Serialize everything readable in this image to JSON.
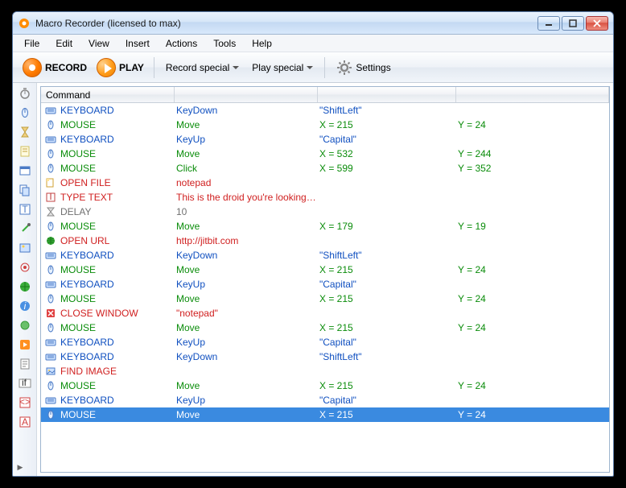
{
  "window": {
    "title": "Macro Recorder (licensed to max)"
  },
  "menubar": [
    "File",
    "Edit",
    "View",
    "Insert",
    "Actions",
    "Tools",
    "Help"
  ],
  "toolbar": {
    "record_label": "RECORD",
    "play_label": "PLAY",
    "record_special": "Record special",
    "play_special": "Play special",
    "settings_label": "Settings"
  },
  "list": {
    "header": "Command",
    "rows": [
      {
        "icon": "kb",
        "cmd": "KEYBOARD",
        "c1": "c-blue",
        "act": "KeyDown",
        "c2": "c-blue",
        "p1": "\"ShiftLeft\"",
        "c3": "c-blue",
        "p2": ""
      },
      {
        "icon": "ms",
        "cmd": "MOUSE",
        "c1": "c-green",
        "act": "Move",
        "c2": "c-green",
        "p1": "X = 215",
        "c3": "c-green",
        "p2": "Y = 24",
        "c4": "c-green"
      },
      {
        "icon": "kb",
        "cmd": "KEYBOARD",
        "c1": "c-blue",
        "act": "KeyUp",
        "c2": "c-blue",
        "p1": "\"Capital\"",
        "c3": "c-blue",
        "p2": ""
      },
      {
        "icon": "ms",
        "cmd": "MOUSE",
        "c1": "c-green",
        "act": "Move",
        "c2": "c-green",
        "p1": "X = 532",
        "c3": "c-green",
        "p2": "Y = 244",
        "c4": "c-green"
      },
      {
        "icon": "ms",
        "cmd": "MOUSE",
        "c1": "c-green",
        "act": "Click",
        "c2": "c-green",
        "p1": "X = 599",
        "c3": "c-green",
        "p2": "Y = 352",
        "c4": "c-green"
      },
      {
        "icon": "of",
        "cmd": "OPEN FILE",
        "c1": "c-red",
        "act": "notepad",
        "c2": "c-red",
        "p1": "",
        "c3": "",
        "p2": ""
      },
      {
        "icon": "tt",
        "cmd": "TYPE TEXT",
        "c1": "c-red",
        "act": "This is the droid you're looking for!",
        "c2": "c-red",
        "p1": "",
        "c3": "",
        "p2": ""
      },
      {
        "icon": "dl",
        "cmd": "DELAY",
        "c1": "c-gray",
        "act": "10",
        "c2": "c-gray",
        "p1": "",
        "c3": "",
        "p2": ""
      },
      {
        "icon": "ms",
        "cmd": "MOUSE",
        "c1": "c-green",
        "act": "Move",
        "c2": "c-green",
        "p1": "X = 179",
        "c3": "c-green",
        "p2": "Y = 19",
        "c4": "c-green"
      },
      {
        "icon": "ou",
        "cmd": "OPEN URL",
        "c1": "c-red",
        "act": "http://jitbit.com",
        "c2": "c-red",
        "p1": "",
        "c3": "",
        "p2": ""
      },
      {
        "icon": "kb",
        "cmd": "KEYBOARD",
        "c1": "c-blue",
        "act": "KeyDown",
        "c2": "c-blue",
        "p1": "\"ShiftLeft\"",
        "c3": "c-blue",
        "p2": ""
      },
      {
        "icon": "ms",
        "cmd": "MOUSE",
        "c1": "c-green",
        "act": "Move",
        "c2": "c-green",
        "p1": "X = 215",
        "c3": "c-green",
        "p2": "Y = 24",
        "c4": "c-green"
      },
      {
        "icon": "kb",
        "cmd": "KEYBOARD",
        "c1": "c-blue",
        "act": "KeyUp",
        "c2": "c-blue",
        "p1": "\"Capital\"",
        "c3": "c-blue",
        "p2": ""
      },
      {
        "icon": "ms",
        "cmd": "MOUSE",
        "c1": "c-green",
        "act": "Move",
        "c2": "c-green",
        "p1": "X = 215",
        "c3": "c-green",
        "p2": "Y = 24",
        "c4": "c-green"
      },
      {
        "icon": "cw",
        "cmd": "CLOSE WINDOW",
        "c1": "c-red",
        "act": "\"notepad\"",
        "c2": "c-red",
        "p1": "",
        "c3": "",
        "p2": ""
      },
      {
        "icon": "ms",
        "cmd": "MOUSE",
        "c1": "c-green",
        "act": "Move",
        "c2": "c-green",
        "p1": "X = 215",
        "c3": "c-green",
        "p2": "Y = 24",
        "c4": "c-green"
      },
      {
        "icon": "kb",
        "cmd": "KEYBOARD",
        "c1": "c-blue",
        "act": "KeyUp",
        "c2": "c-blue",
        "p1": "\"Capital\"",
        "c3": "c-blue",
        "p2": ""
      },
      {
        "icon": "kb",
        "cmd": "KEYBOARD",
        "c1": "c-blue",
        "act": "KeyDown",
        "c2": "c-blue",
        "p1": "\"ShiftLeft\"",
        "c3": "c-blue",
        "p2": ""
      },
      {
        "icon": "fi",
        "cmd": "FIND IMAGE",
        "c1": "c-red",
        "act": "",
        "c2": "",
        "p1": "",
        "c3": "",
        "p2": ""
      },
      {
        "icon": "ms",
        "cmd": "MOUSE",
        "c1": "c-green",
        "act": "Move",
        "c2": "c-green",
        "p1": "X = 215",
        "c3": "c-green",
        "p2": "Y = 24",
        "c4": "c-green"
      },
      {
        "icon": "kb",
        "cmd": "KEYBOARD",
        "c1": "c-blue",
        "act": "KeyUp",
        "c2": "c-blue",
        "p1": "\"Capital\"",
        "c3": "c-blue",
        "p2": ""
      },
      {
        "icon": "ms",
        "cmd": "MOUSE",
        "c1": "c-green",
        "act": "Move",
        "c2": "c-green",
        "p1": "X = 215",
        "c3": "c-green",
        "p2": "Y = 24",
        "c4": "c-green",
        "selected": true
      }
    ]
  },
  "sidebar_icons": [
    "timer-icon",
    "mouse-icon",
    "hourglass-icon",
    "note-icon",
    "window-icon",
    "copy-icon",
    "text-icon",
    "eyedropper-icon",
    "photo-icon",
    "target-icon",
    "globe-icon",
    "info-icon",
    "sphere-icon",
    "run-icon",
    "script-icon",
    "if-icon",
    "code-icon",
    "font-icon"
  ]
}
